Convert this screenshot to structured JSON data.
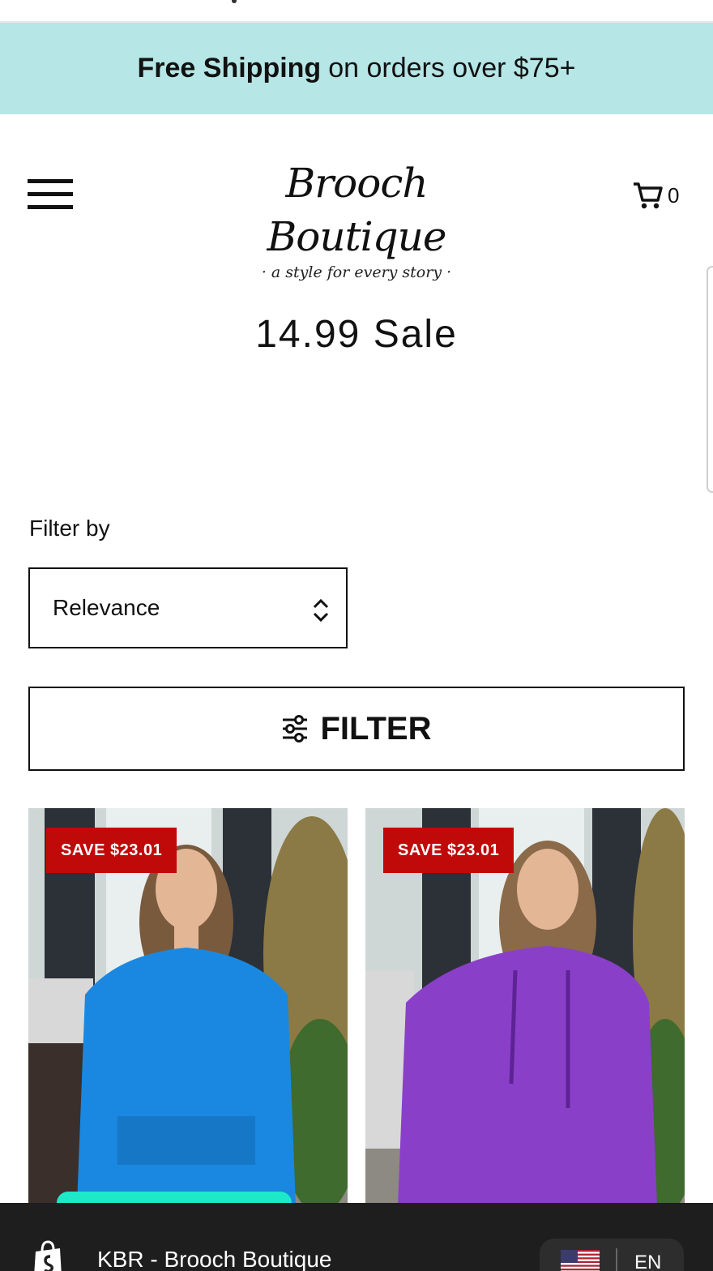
{
  "promo": {
    "bold": "Free Shipping",
    "rest": "on orders over $75+",
    "bg": "#b6e6e6"
  },
  "header": {
    "brand_name": "Brooch Boutique",
    "brand_tagline": "· a style for every story ·",
    "cart_count": "0"
  },
  "page": {
    "title": "14.99 Sale"
  },
  "filters": {
    "filter_label": "Filter by",
    "sort_value": "Relevance",
    "filter_button": "FILTER"
  },
  "products": [
    {
      "badge": "SAVE $23.01",
      "color": "#1a88e0"
    },
    {
      "badge": "SAVE $23.01",
      "color": "#8a3fc9"
    }
  ],
  "shop_bar": {
    "store_name": "KBR - Brooch Boutique",
    "language": "EN"
  },
  "colors": {
    "sale_badge": "#c00a0a",
    "accent_strip": "#1de9c8",
    "bar": "#1e1e1e"
  }
}
